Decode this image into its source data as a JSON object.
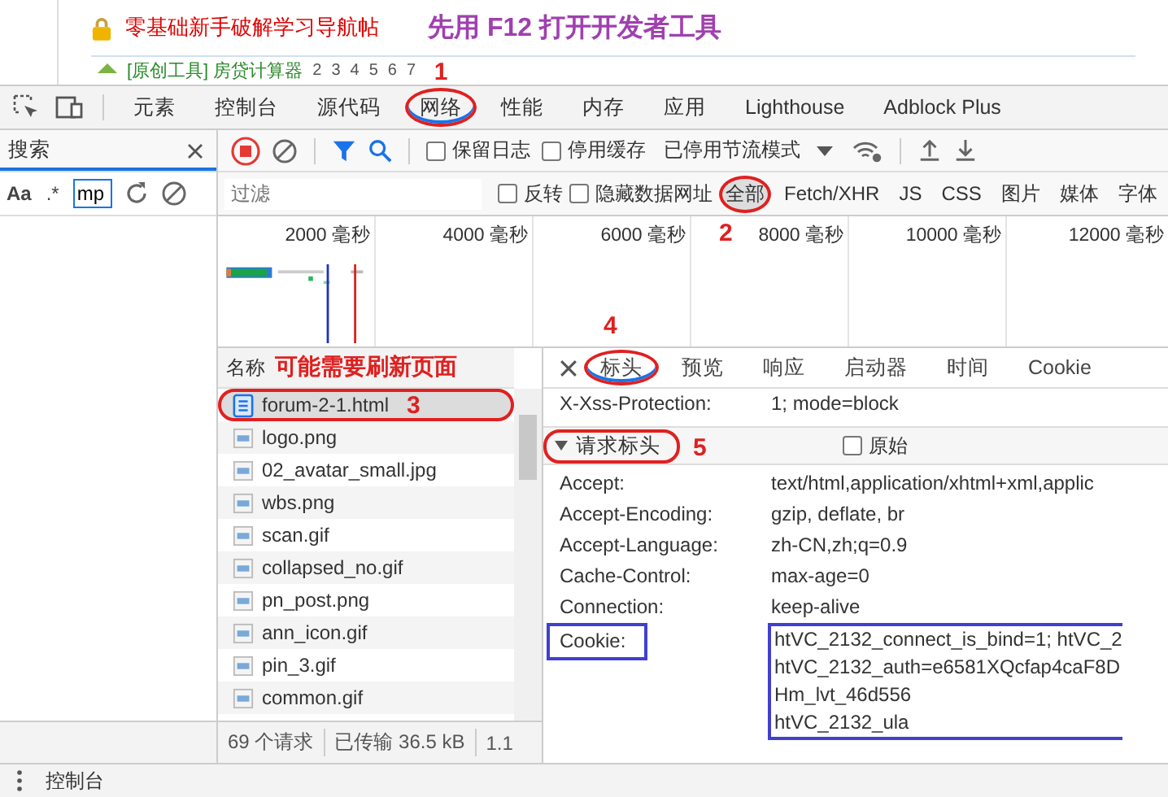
{
  "page": {
    "title": "零基础新手破解学习导航帖",
    "annotation": "先用 F12 打开开发者工具",
    "thread": "[原创工具] 房贷计算器",
    "pages": [
      "2",
      "3",
      "4",
      "5",
      "6",
      "7"
    ]
  },
  "tabs": [
    {
      "label": "元素",
      "selected": false,
      "circled": false
    },
    {
      "label": "控制台",
      "selected": false,
      "circled": false
    },
    {
      "label": "源代码",
      "selected": false,
      "circled": false
    },
    {
      "label": "网络",
      "selected": true,
      "circled": true,
      "note": "1"
    },
    {
      "label": "性能",
      "selected": false,
      "circled": false
    },
    {
      "label": "内存",
      "selected": false,
      "circled": false
    },
    {
      "label": "应用",
      "selected": false,
      "circled": false
    },
    {
      "label": "Lighthouse",
      "selected": false,
      "circled": false
    },
    {
      "label": "Adblock Plus",
      "selected": false,
      "circled": false
    }
  ],
  "search": {
    "title": "搜索",
    "case_label": "Aa",
    "regex_label": ".*",
    "value": "mp"
  },
  "toolbar": {
    "options": [
      {
        "label": "保留日志",
        "checked": false
      },
      {
        "label": "停用缓存",
        "checked": false
      }
    ],
    "throttle": "已停用节流模式"
  },
  "filter": {
    "placeholder": "过滤",
    "options": [
      {
        "label": "反转",
        "checked": false
      },
      {
        "label": "隐藏数据网址",
        "checked": false
      }
    ],
    "types": [
      {
        "label": "全部",
        "selected": true,
        "circled": true,
        "note": "2"
      },
      {
        "label": "Fetch/XHR",
        "selected": false,
        "circled": false
      },
      {
        "label": "JS",
        "selected": false,
        "circled": false
      },
      {
        "label": "CSS",
        "selected": false,
        "circled": false
      },
      {
        "label": "图片",
        "selected": false,
        "circled": false
      },
      {
        "label": "媒体",
        "selected": false,
        "circled": false
      },
      {
        "label": "字体",
        "selected": false,
        "circled": false
      }
    ]
  },
  "timeline": {
    "ticks": [
      "2000 毫秒",
      "4000 毫秒",
      "6000 毫秒",
      "8000 毫秒",
      "10000 毫秒",
      "12000 毫秒"
    ]
  },
  "requests": {
    "header": "名称",
    "annotation": "可能需要刷新页面",
    "rows": [
      {
        "name": "forum-2-1.html",
        "kind": "document",
        "selected": true,
        "circled": true,
        "note": "3"
      },
      {
        "name": "logo.png",
        "kind": "image",
        "selected": false,
        "circled": false
      },
      {
        "name": "02_avatar_small.jpg",
        "kind": "image",
        "selected": false,
        "circled": false
      },
      {
        "name": "wbs.png",
        "kind": "image",
        "selected": false,
        "circled": false
      },
      {
        "name": "scan.gif",
        "kind": "image",
        "selected": false,
        "circled": false
      },
      {
        "name": "collapsed_no.gif",
        "kind": "image",
        "selected": false,
        "circled": false
      },
      {
        "name": "pn_post.png",
        "kind": "image",
        "selected": false,
        "circled": false
      },
      {
        "name": "ann_icon.gif",
        "kind": "image",
        "selected": false,
        "circled": false
      },
      {
        "name": "pin_3.gif",
        "kind": "image",
        "selected": false,
        "circled": false
      },
      {
        "name": "common.gif",
        "kind": "image",
        "selected": false,
        "circled": false
      }
    ]
  },
  "status": [
    "69 个请求",
    "已传输 36.5 kB",
    "1.1"
  ],
  "details": {
    "tabs": [
      {
        "label": "标头",
        "selected": true,
        "circled": true,
        "note": "4"
      },
      {
        "label": "预览",
        "selected": false,
        "circled": false
      },
      {
        "label": "响应",
        "selected": false,
        "circled": false
      },
      {
        "label": "启动器",
        "selected": false,
        "circled": false
      },
      {
        "label": "时间",
        "selected": false,
        "circled": false
      },
      {
        "label": "Cookie",
        "selected": false,
        "circled": false
      }
    ],
    "rows": [
      {
        "kind": "header",
        "key": "X-Xss-Protection:",
        "values": [
          "1; mode=block"
        ],
        "boxed": false
      },
      {
        "kind": "section",
        "label": "请求标头",
        "expanded": true,
        "circled": true,
        "note": "5",
        "raw": {
          "label": "原始",
          "checked": false
        }
      },
      {
        "kind": "header",
        "key": "Accept:",
        "values": [
          "text/html,application/xhtml+xml,applic"
        ],
        "boxed": false
      },
      {
        "kind": "header",
        "key": "Accept-Encoding:",
        "values": [
          "gzip, deflate, br"
        ],
        "boxed": false
      },
      {
        "kind": "header",
        "key": "Accept-Language:",
        "values": [
          "zh-CN,zh;q=0.9"
        ],
        "boxed": false
      },
      {
        "kind": "header",
        "key": "Cache-Control:",
        "values": [
          "max-age=0"
        ],
        "boxed": false
      },
      {
        "kind": "header",
        "key": "Connection:",
        "values": [
          "keep-alive"
        ],
        "boxed": false
      },
      {
        "kind": "header",
        "key": "Cookie:",
        "values": [
          "htVC_2132_connect_is_bind=1; htVC_2",
          "htVC_2132_auth=e6581XQcfap4caF8D",
          "Hm_lvt_46d556",
          "htVC_2132_ula"
        ],
        "boxed": true
      }
    ]
  },
  "drawer": {
    "label": "控制台"
  }
}
